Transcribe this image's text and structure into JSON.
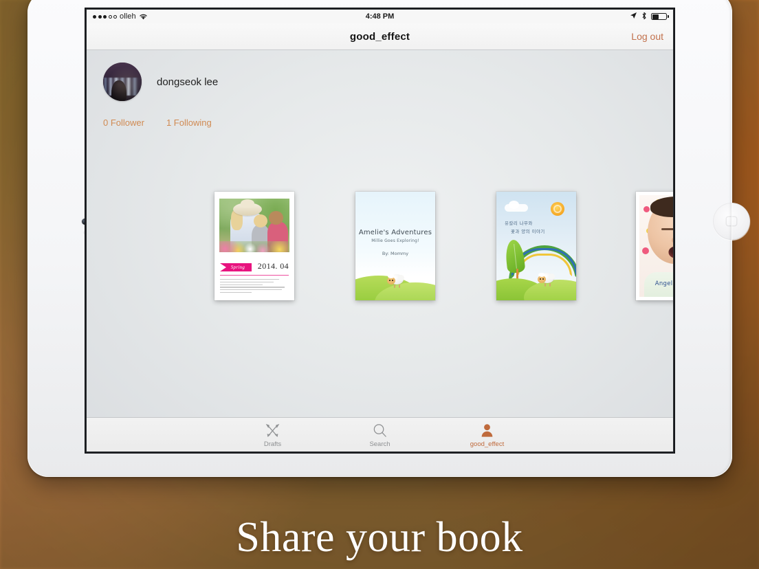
{
  "status_bar": {
    "carrier": "olleh",
    "signal_dots_filled": 3,
    "signal_dots_total": 5,
    "wifi_icon": "wifi-icon",
    "time": "4:48 PM",
    "location_icon": "location-arrow-icon",
    "bluetooth_icon": "bluetooth-icon",
    "battery_icon": "battery-icon"
  },
  "nav": {
    "title": "good_effect",
    "logout_label": "Log out",
    "logout_color": "#c2714c"
  },
  "profile": {
    "avatar_name": "night-cityscape-portrait",
    "username": "dongseok lee",
    "followers": "0 Follower",
    "following": "1 Following",
    "stat_color": "#d08a52"
  },
  "books": [
    {
      "name": "spring-photo-book",
      "ribbon": "Spring",
      "date": "2014. 04",
      "accent": "#e8137f",
      "body_lines": 6,
      "cover_type": "photo-collage"
    },
    {
      "name": "amelies-adventures-book",
      "title": "Amelie's Adventures",
      "subtitle": "Millie Goes Exploring!",
      "author": "By: Mommy",
      "cover_type": "sheep-hills"
    },
    {
      "name": "korean-sheep-book",
      "line1": "유칼리 나무와",
      "line2": "꽃과 양의 이야기",
      "cover_type": "sun-rainbow-sheep"
    },
    {
      "name": "angelas-story-book",
      "title": "Angela's story",
      "title_color": "#2d4f8e",
      "cover_type": "baby-photo"
    }
  ],
  "tabs": [
    {
      "name": "drafts",
      "label": "Drafts",
      "icon": "pencil-ruler-cross-icon",
      "active": false
    },
    {
      "name": "search",
      "label": "Search",
      "icon": "magnifier-icon",
      "active": false
    },
    {
      "name": "profile",
      "label": "good_effect",
      "icon": "person-icon",
      "active": true
    }
  ],
  "banner": {
    "text": "Share your book"
  }
}
